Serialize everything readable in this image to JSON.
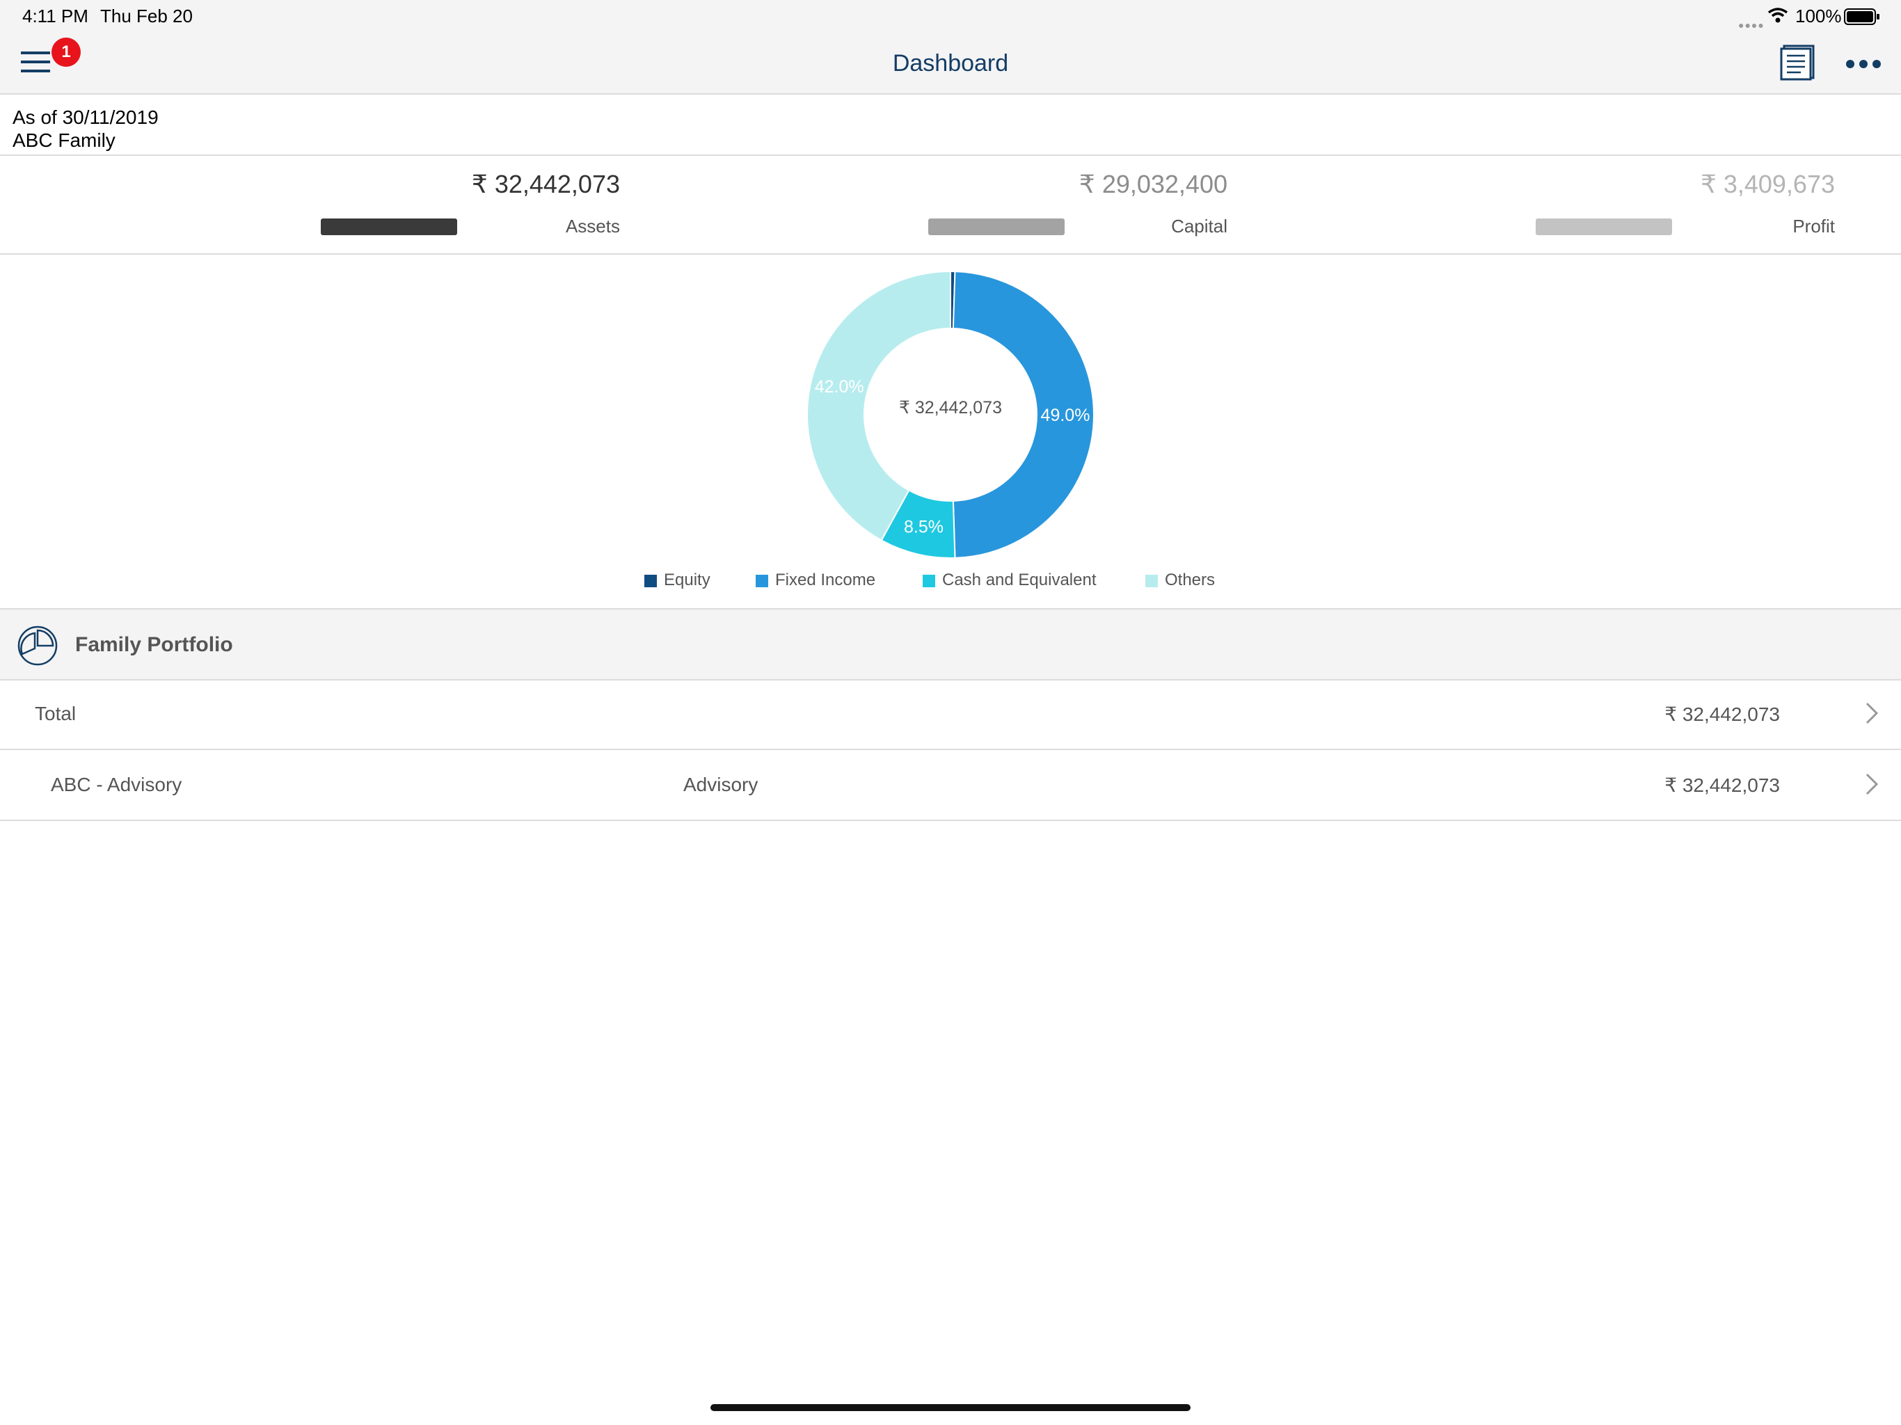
{
  "status_bar": {
    "time": "4:11 PM",
    "date": "Thu Feb 20",
    "battery": "100%"
  },
  "nav": {
    "title": "Dashboard",
    "menu_badge": "1",
    "icons": [
      "menu-icon",
      "report-icon",
      "more-icon"
    ]
  },
  "header": {
    "as_of": "As of 30/11/2019",
    "family": "ABC Family"
  },
  "summary": [
    {
      "value": "₹ 32,442,073",
      "label": "Assets",
      "value_color": "#333333",
      "bar_color": "#3a3a3a"
    },
    {
      "value": "₹ 29,032,400",
      "label": "Capital",
      "value_color": "#8c8c8c",
      "bar_color": "#a3a3a3"
    },
    {
      "value": "₹ 3,409,673",
      "label": "Profit",
      "value_color": "#b4b4b4",
      "bar_color": "#c3c3c3"
    }
  ],
  "chart_data": {
    "type": "pie",
    "center_label": "₹ 32,442,073",
    "categories": [
      "Equity",
      "Fixed Income",
      "Cash and Equivalent",
      "Others"
    ],
    "values": [
      0.5,
      49.0,
      8.5,
      42.0
    ],
    "data_labels": [
      "",
      "49.0%",
      "8.5%",
      "42.0%"
    ],
    "colors": [
      "#0f4c81",
      "#2896dc",
      "#1ec8e0",
      "#b7ecee"
    ],
    "legend_position": "bottom"
  },
  "section": {
    "title": "Family Portfolio"
  },
  "rows": [
    {
      "name": "Total",
      "type": "",
      "amount": "₹ 32,442,073"
    },
    {
      "name": "ABC - Advisory",
      "type": "Advisory",
      "amount": "₹ 32,442,073"
    }
  ]
}
